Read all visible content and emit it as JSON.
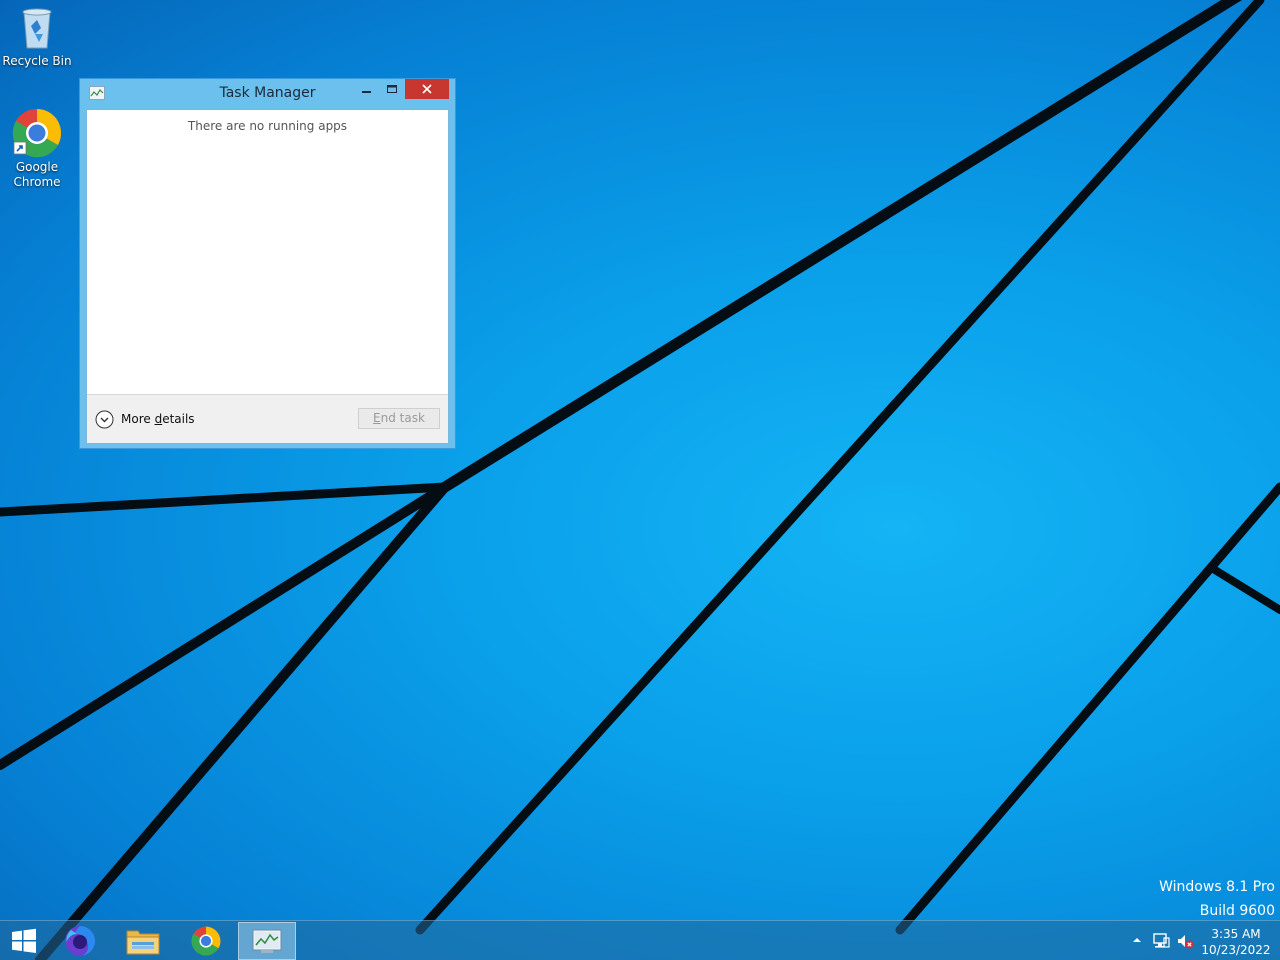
{
  "desktop": {
    "icons": [
      {
        "label": "Recycle Bin",
        "icon": "recycle-bin-icon"
      },
      {
        "label": "Google Chrome",
        "icon": "chrome-icon"
      }
    ],
    "watermark": {
      "line1": "Windows 8.1 Pro",
      "line2": "Build 9600"
    }
  },
  "window": {
    "title": "Task Manager",
    "message": "There are no running apps",
    "more_details_prefix": "More ",
    "more_details_underlined": "d",
    "more_details_rest": "etails",
    "end_task_underlined": "E",
    "end_task_rest": "nd task"
  },
  "taskbar": {
    "items": [
      "start-button",
      "firefox",
      "file-explorer",
      "chrome",
      "task-manager"
    ],
    "active": "task-manager",
    "clock": {
      "time": "3:35 AM",
      "date": "10/23/2022"
    }
  },
  "colors": {
    "accent": "#0aa0ea",
    "close_button": "#c7372f",
    "window_frame": "#6cc0ee"
  }
}
